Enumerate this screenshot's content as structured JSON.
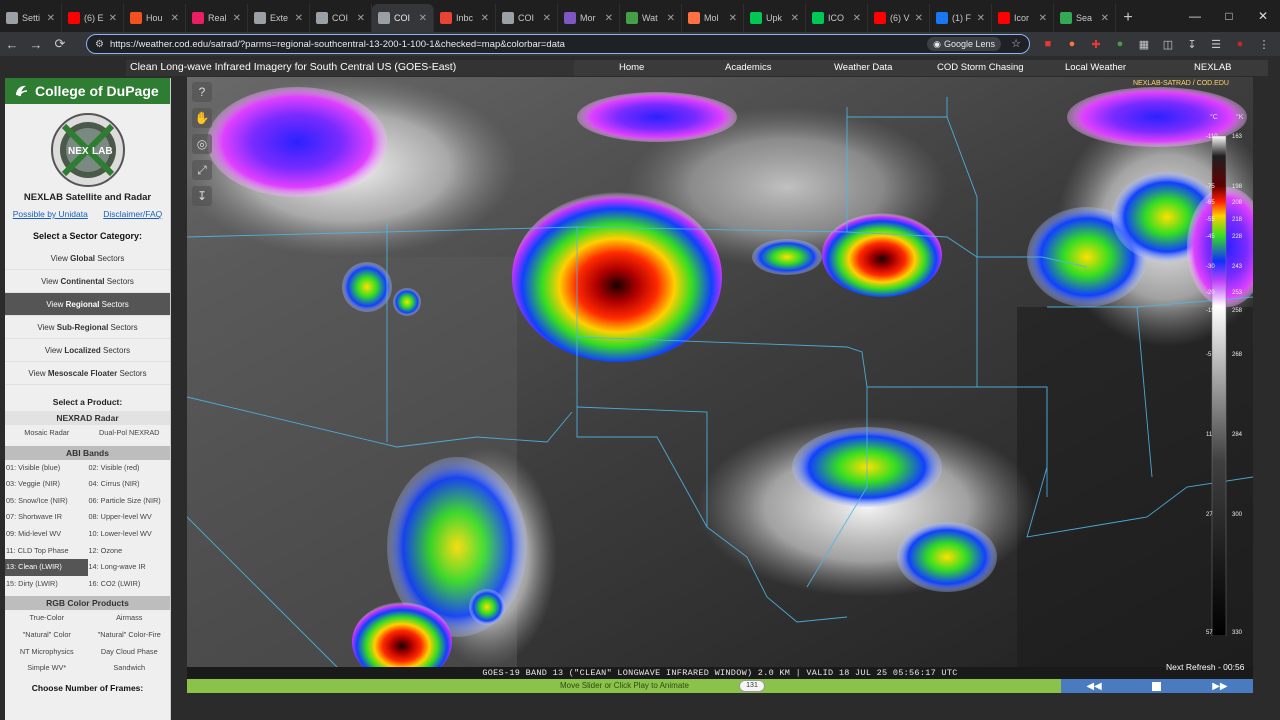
{
  "browser": {
    "tabs": [
      {
        "label": "Setti",
        "color": "#9aa0a6"
      },
      {
        "label": "(6) E",
        "color": "#ff0000"
      },
      {
        "label": "Hou",
        "color": "#f4511e"
      },
      {
        "label": "Real",
        "color": "#e91e63"
      },
      {
        "label": "Exte",
        "color": "#9aa0a6"
      },
      {
        "label": "COI",
        "color": "#9aa0a6"
      },
      {
        "label": "COI",
        "color": "#9aa0a6"
      },
      {
        "label": "Inbc",
        "color": "#ea4335"
      },
      {
        "label": "COI",
        "color": "#9aa0a6"
      },
      {
        "label": "Mor",
        "color": "#7e57c2"
      },
      {
        "label": "Wat",
        "color": "#43a047"
      },
      {
        "label": "Mol",
        "color": "#ff7043"
      },
      {
        "label": "Upk",
        "color": "#00c853"
      },
      {
        "label": "ICO",
        "color": "#00c853"
      },
      {
        "label": "(6) V",
        "color": "#ff0000"
      },
      {
        "label": "(1) F",
        "color": "#1877f2"
      },
      {
        "label": "Icor",
        "color": "#ff0000"
      },
      {
        "label": "Sea",
        "color": "#34a853"
      }
    ],
    "url": "https://weather.cod.edu/satrad/?parms=regional-southcentral-13-200-1-100-1&checked=map&colorbar=data",
    "lens_label": "Google Lens"
  },
  "page": {
    "title": "Clean Long-wave Infrared Imagery for South Central US (GOES-East)",
    "nav": [
      "Home",
      "Academics",
      "Weather Data",
      "COD Storm Chasing",
      "Local Weather",
      "NEXLAB"
    ]
  },
  "sidebar": {
    "college": "College of DuPage",
    "logo_text_left": "NEX",
    "logo_text_right": "LAB",
    "site_title": "NEXLAB Satellite and Radar",
    "link_unidata": "Possible by Unidata",
    "link_disclaimer": "Disclaimer/FAQ",
    "sector_heading": "Select a Sector Category:",
    "sectors": [
      {
        "pre": "View ",
        "bold": "Global",
        "post": " Sectors",
        "active": false
      },
      {
        "pre": "View ",
        "bold": "Continental",
        "post": " Sectors",
        "active": false
      },
      {
        "pre": "View ",
        "bold": "Regional",
        "post": " Sectors",
        "active": true
      },
      {
        "pre": "View ",
        "bold": "Sub-Regional",
        "post": " Sectors",
        "active": false
      },
      {
        "pre": "View ",
        "bold": "Localized",
        "post": " Sectors",
        "active": false
      },
      {
        "pre": "View ",
        "bold": "Mesoscale Floater",
        "post": " Sectors",
        "active": false
      }
    ],
    "product_heading": "Select a Product:",
    "nexrad_heading": "NEXRAD Radar",
    "nexrad": [
      "Mosaic Radar",
      "Dual-Pol NEXRAD"
    ],
    "abi_heading": "ABI Bands",
    "abi": [
      "01: Visible (blue)",
      "02: Visible (red)",
      "03: Veggie (NIR)",
      "04: Cirrus (NIR)",
      "05: Snow/Ice (NIR)",
      "06: Particle Size (NIR)",
      "07: Shortwave IR",
      "08: Upper-level WV",
      "09: Mid-level WV",
      "10: Lower-level WV",
      "11: CLD Top Phase",
      "12: Ozone",
      "13: Clean (LWIR)",
      "14: Long-wave IR",
      "15: Dirty (LWIR)",
      "16: CO2 (LWIR)"
    ],
    "abi_selected": "13: Clean (LWIR)",
    "rgb_heading": "RGB Color Products",
    "rgb": [
      "True-Color",
      "Airmass",
      "\"Natural\" Color",
      "\"Natural\" Color-Fire",
      "NT Microphysics",
      "Day Cloud Phase",
      "Simple WV*",
      "Sandwich"
    ],
    "frames_heading": "Choose Number of Frames:"
  },
  "map": {
    "caption": "GOES-19 BAND 13 (\"CLEAN\" LONGWAVE INFRARED WINDOW) 2.0 KM | VALID 18 JUL 25 05:56:17 UTC",
    "next_refresh": "Next Refresh - 00:56",
    "corner_tag": "NEXLAB-SATRAD / COD.EDU",
    "colorbar_units_left": "°C",
    "colorbar_units_right": "°K",
    "colorbar_ticks": [
      {
        "c": "-110",
        "k": "163"
      },
      {
        "c": "-75",
        "k": "198"
      },
      {
        "c": "-65",
        "k": "208"
      },
      {
        "c": "-55",
        "k": "218"
      },
      {
        "c": "-45",
        "k": "228"
      },
      {
        "c": "-30",
        "k": "243"
      },
      {
        "c": "-20",
        "k": "253"
      },
      {
        "c": "-15",
        "k": "258"
      },
      {
        "c": "-5",
        "k": "268"
      },
      {
        "c": "11",
        "k": "284"
      },
      {
        "c": "27",
        "k": "300"
      },
      {
        "c": "57",
        "k": "330"
      }
    ]
  },
  "animation": {
    "hint": "Move Slider or Click Play to Animate",
    "frame": "131"
  },
  "colors": {
    "cod_green": "#2e7d32",
    "slider_green": "#8bc34a",
    "control_blue": "#4a7bc1",
    "border_cyan": "#4fb6e8"
  }
}
